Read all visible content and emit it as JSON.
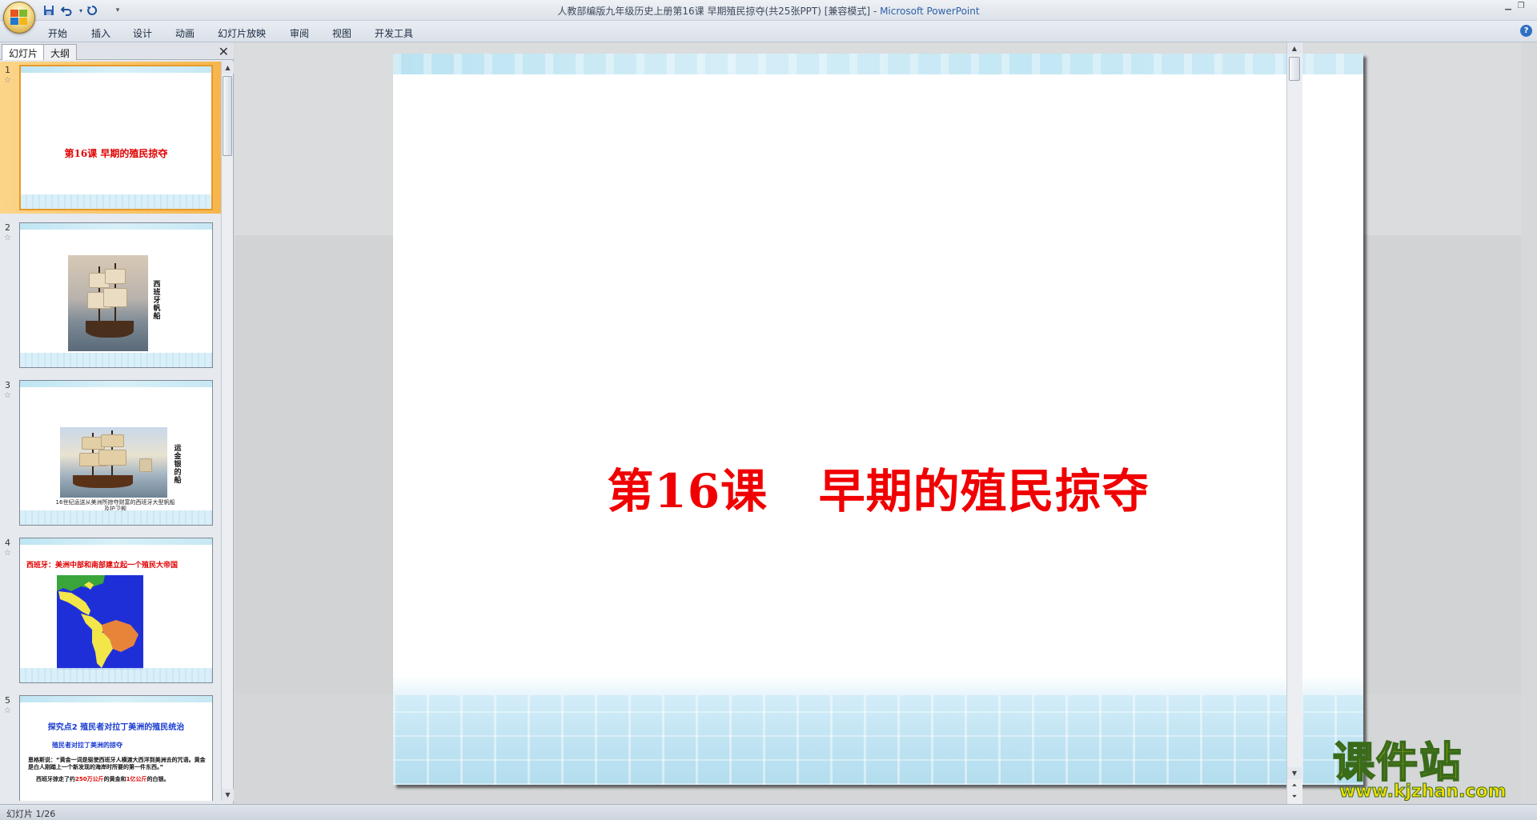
{
  "window": {
    "title_doc": "人教部编版九年级历史上册第16课  早期殖民掠夺(共25张PPT) [兼容模式] - ",
    "title_app": "Microsoft PowerPoint"
  },
  "quick_access": {
    "save_icon": "save-icon",
    "undo_icon": "undo-icon",
    "redo_icon": "redo-icon",
    "customize_icon": "dropdown-icon"
  },
  "ribbon": {
    "tabs": [
      "开始",
      "插入",
      "设计",
      "动画",
      "幻灯片放映",
      "审阅",
      "视图",
      "开发工具"
    ],
    "help_label": "?"
  },
  "panel": {
    "tab_slides": "幻灯片",
    "tab_outline": "大纲",
    "close_label": "✕"
  },
  "thumbnails": [
    {
      "num": "1",
      "title": "第16课   早期的殖民掠夺"
    },
    {
      "num": "2",
      "vertical_text": "西班牙帆船"
    },
    {
      "num": "3",
      "vertical_text": "运金银的船",
      "caption": "16世纪运送从美洲所掠夺财富的西班牙大型帆船及护卫舰"
    },
    {
      "num": "4",
      "title": "西班牙：美洲中部和南部建立起一个殖民大帝国"
    },
    {
      "num": "5",
      "heading": "探究点2 殖民者对拉丁美洲的殖民统治",
      "sub": "殖民者对拉丁美洲的掠夺",
      "body1": "恩格斯说：“黄金一词是驱使西班牙人横渡大西洋到美洲去的咒语。黄金是白人刚踏上一个新发现的海岸时所要的第一件东西。”",
      "body2_pre": "西班牙掠走了约",
      "body2_red1": "250万公斤",
      "body2_mid": "的黄金和",
      "body2_red2": "1亿公斤",
      "body2_post": "的白银。"
    }
  ],
  "slide": {
    "title": "第16课   早期的殖民掠夺"
  },
  "watermark": {
    "big": "课件站",
    "url": "www.kjzhan.com"
  },
  "status": {
    "text": "幻灯片 1/26"
  }
}
